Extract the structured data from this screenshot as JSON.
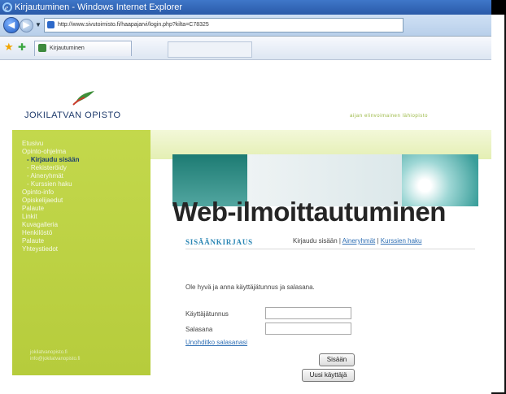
{
  "window": {
    "title": "Kirjautuminen - Windows Internet Explorer",
    "url": "http://www.sivutoimisto.fi/haapajarvi/login.php?kilta=C78325"
  },
  "tab": {
    "label": "Kirjautuminen"
  },
  "header": {
    "logo_text": "JOKILATVAN OPISTO",
    "tagline": "aijan elinvoimainen lähiopisto"
  },
  "sidebar": {
    "items": [
      {
        "label": "Etusivu",
        "level": 0,
        "active": false
      },
      {
        "label": "Opinto-ohjelma",
        "level": 0,
        "active": false
      },
      {
        "label": "- Kirjaudu sisään",
        "level": 1,
        "active": true
      },
      {
        "label": "- Rekisteröidy",
        "level": 1,
        "active": false
      },
      {
        "label": "- Aineryhmät",
        "level": 1,
        "active": false
      },
      {
        "label": "- Kurssien haku",
        "level": 1,
        "active": false
      },
      {
        "label": "Opinto-info",
        "level": 0,
        "active": false
      },
      {
        "label": "Opiskelijaedut",
        "level": 0,
        "active": false
      },
      {
        "label": "Palaute",
        "level": 0,
        "active": false
      },
      {
        "label": "Linkit",
        "level": 0,
        "active": false
      },
      {
        "label": "Kuvagalleria",
        "level": 0,
        "active": false
      },
      {
        "label": "Henkilöstö",
        "level": 0,
        "active": false
      },
      {
        "label": "Palaute",
        "level": 0,
        "active": false
      },
      {
        "label": "Yhteystiedot",
        "level": 0,
        "active": false
      }
    ],
    "footer_lines": [
      "jokilatvanopisto.fi",
      "info@jokilatvanopisto.fi"
    ]
  },
  "main": {
    "title": "Web-ilmoittautuminen",
    "section_heading": "SISÄÄNKIRJAUS",
    "links_prefix": "Kirjaudu sisään | ",
    "link_groups": "Aineryhmät",
    "links_sep": " | ",
    "link_search": "Kurssien haku",
    "intro": "Ole hyvä ja anna käyttäjätunnus ja salasana.",
    "username_label": "Käyttäjätunnus",
    "username_value": "",
    "password_label": "Salasana",
    "password_value": "",
    "forgot_link": "Unohditko salasanasi",
    "login_button": "Sisään",
    "new_user_button": "Uusi käyttäjä"
  },
  "colors": {
    "sidebar_green": "#bdd245",
    "heading_blue": "#2a86b4",
    "link_blue": "#2f6fb4"
  }
}
